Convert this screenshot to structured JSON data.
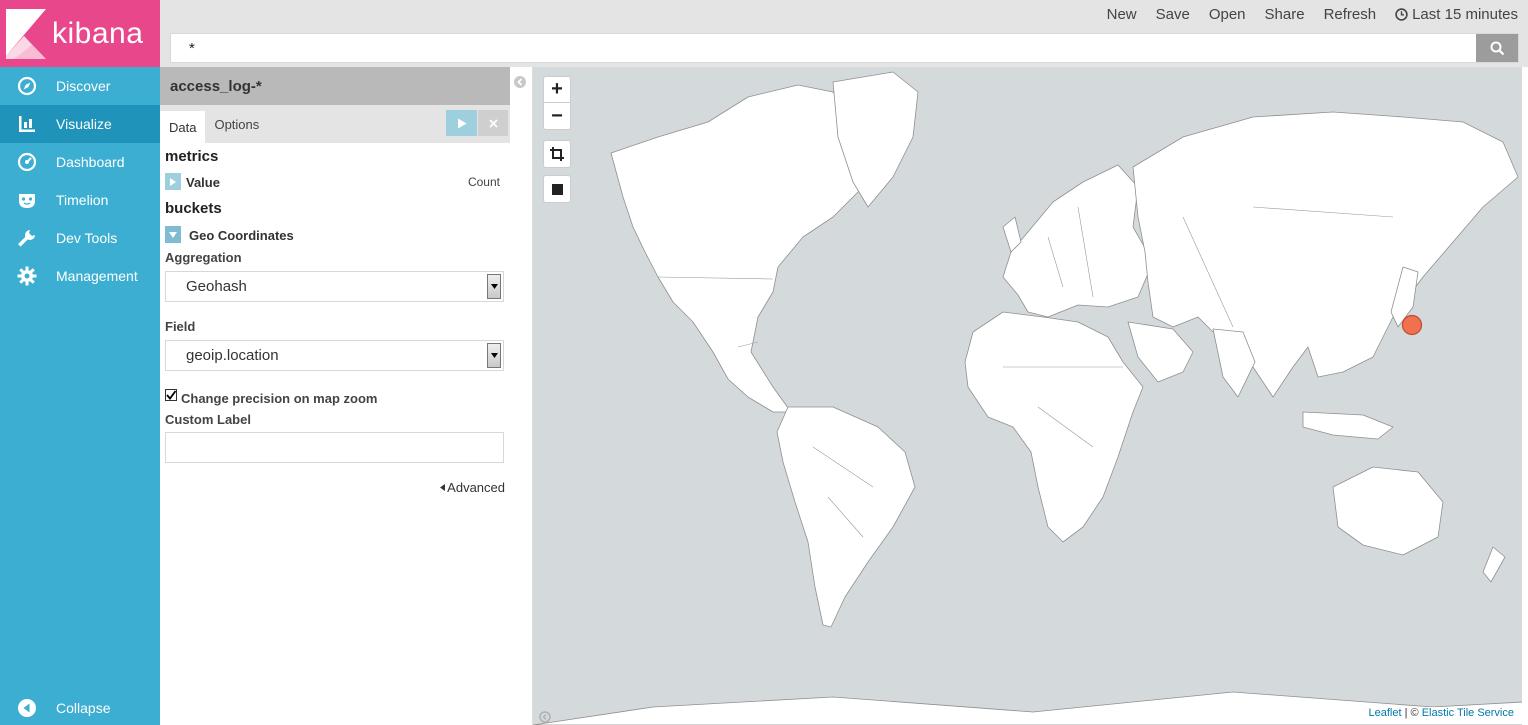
{
  "app": {
    "logo_text": "kibana",
    "colors": {
      "brand_pink": "#e8488b",
      "sidebar_blue": "#3caed2",
      "sidebar_active": "#1f93b9",
      "marker_orange": "#f0714f"
    }
  },
  "sidebar": {
    "items": [
      {
        "label": "Discover",
        "icon": "compass-icon"
      },
      {
        "label": "Visualize",
        "icon": "bar-chart-icon"
      },
      {
        "label": "Dashboard",
        "icon": "dashboard-gauge-icon"
      },
      {
        "label": "Timelion",
        "icon": "timelion-mask-icon"
      },
      {
        "label": "Dev Tools",
        "icon": "wrench-icon"
      },
      {
        "label": "Management",
        "icon": "gear-icon"
      }
    ],
    "active": "Visualize",
    "collapse_label": "Collapse"
  },
  "topbar": {
    "menu": {
      "new": "New",
      "save": "Save",
      "open": "Open",
      "share": "Share",
      "refresh": "Refresh",
      "time": "Last 15 minutes"
    },
    "query": {
      "value": "*"
    }
  },
  "editor": {
    "index_pattern": "access_log-*",
    "tabs": {
      "data": "Data",
      "options": "Options"
    },
    "metrics": {
      "title": "metrics",
      "agg_label": "Value",
      "agg_type": "Count"
    },
    "buckets": {
      "title": "buckets",
      "agg_label": "Geo Coordinates",
      "aggregation_label": "Aggregation",
      "aggregation_value": "Geohash",
      "field_label": "Field",
      "field_value": "geoip.location",
      "precision_checkbox_label": "Change precision on map zoom",
      "precision_checked": true,
      "custom_label_label": "Custom Label",
      "custom_label_value": "",
      "advanced_label": "Advanced"
    }
  },
  "map": {
    "attribution_leaflet": "Leaflet",
    "attribution_sep": " | © ",
    "attribution_tiles": "Elastic Tile Service",
    "zoom_in": "+",
    "zoom_out": "−"
  }
}
